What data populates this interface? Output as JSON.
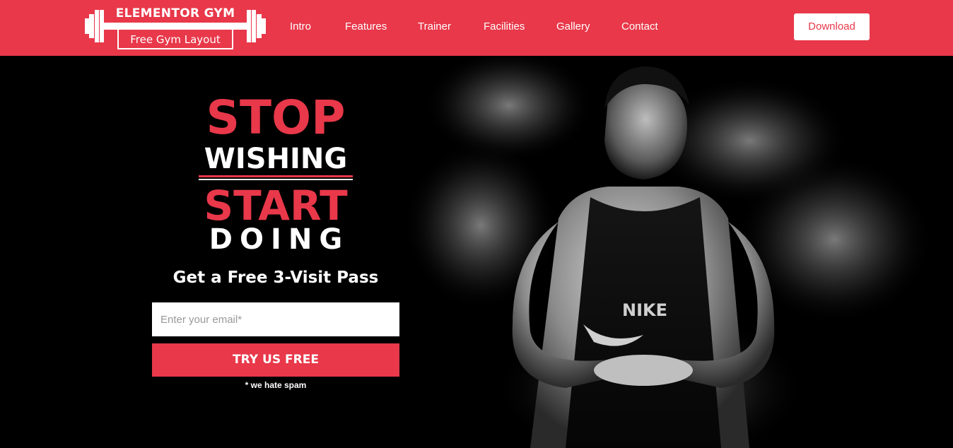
{
  "header": {
    "logo": {
      "title": "ELEMENTOR GYM",
      "subtitle": "Free Gym Layout",
      "icon": "barbell-icon"
    },
    "nav": [
      "Intro",
      "Features",
      "Trainer",
      "Facilities",
      "Gallery",
      "Contact"
    ],
    "download_label": "Download"
  },
  "hero": {
    "headline": {
      "line1": "STOP",
      "line2": "WISHING",
      "line3": "START",
      "line4": "DOING"
    },
    "offer": "Get a Free 3-Visit Pass",
    "email_placeholder": "Enter your email*",
    "cta_label": "TRY US FREE",
    "spam_note": "* we hate spam",
    "shirt_text": "NIKE"
  },
  "colors": {
    "brand_red": "#e8384a",
    "background": "#000000",
    "text_light": "#ffffff"
  }
}
